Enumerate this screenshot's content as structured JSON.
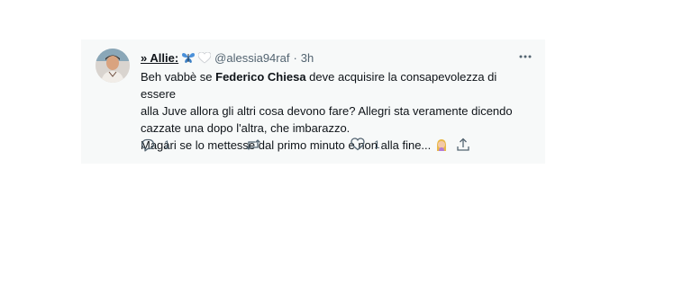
{
  "tweet": {
    "display_name": "» Allie:",
    "handle": "@alessia94raf",
    "separator": "·",
    "time": "3h",
    "text_lines": [
      {
        "pre": "Beh vabbè se ",
        "bold": "Federico Chiesa",
        "post": " deve acquisire la consapevolezza di essere"
      },
      {
        "pre": "alla Juve allora gli altri cosa devono fare? Allegri sta veramente dicendo",
        "bold": "",
        "post": ""
      },
      {
        "pre": "cazzate una dopo l'altra, che imbarazzo.",
        "bold": "",
        "post": ""
      },
      {
        "pre": "Magari se lo mettesse dal primo minuto e non alla fine... ",
        "bold": "",
        "post": ""
      }
    ],
    "reply_count": "1",
    "retweet_count": "",
    "like_count": "1"
  },
  "colors": {
    "card_bg": "#f7f9f9",
    "text": "#0f1419",
    "muted": "#536471",
    "butterfly": "#4a90d9"
  },
  "icons": {
    "reply": "reply-icon",
    "retweet": "retweet-icon",
    "like": "heart-icon",
    "share": "share-icon",
    "more": "more-dots-icon"
  }
}
